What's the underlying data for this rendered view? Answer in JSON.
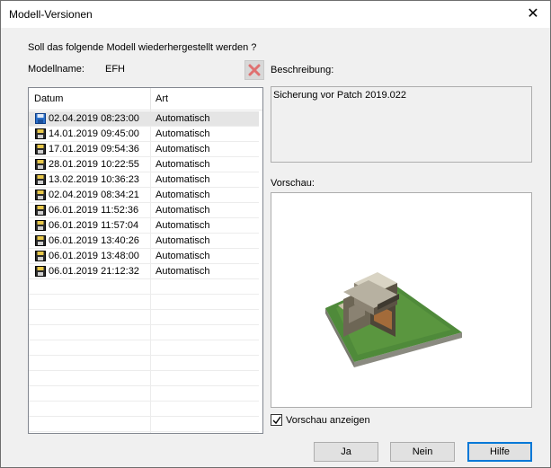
{
  "window": {
    "title": "Modell-Versionen"
  },
  "prompt": "Soll das folgende Modell wiederhergestellt werden ?",
  "model": {
    "label": "Modellname:",
    "value": "EFH"
  },
  "description": {
    "label": "Beschreibung:",
    "text": "Sicherung vor Patch 2019.022"
  },
  "preview": {
    "label": "Vorschau:",
    "checkbox_label": "Vorschau anzeigen",
    "checked": true
  },
  "list": {
    "columns": [
      "Datum",
      "Art"
    ],
    "rows": [
      {
        "date": "02.04.2019 08:23:00",
        "type": "Automatisch",
        "selected": true
      },
      {
        "date": "14.01.2019 09:45:00",
        "type": "Automatisch"
      },
      {
        "date": "17.01.2019 09:54:36",
        "type": "Automatisch"
      },
      {
        "date": "28.01.2019 10:22:55",
        "type": "Automatisch"
      },
      {
        "date": "13.02.2019 10:36:23",
        "type": "Automatisch"
      },
      {
        "date": "02.04.2019 08:34:21",
        "type": "Automatisch"
      },
      {
        "date": "06.01.2019 11:52:36",
        "type": "Automatisch"
      },
      {
        "date": "06.01.2019 11:57:04",
        "type": "Automatisch"
      },
      {
        "date": "06.01.2019 13:40:26",
        "type": "Automatisch"
      },
      {
        "date": "06.01.2019 13:48:00",
        "type": "Automatisch"
      },
      {
        "date": "06.01.2019 21:12:32",
        "type": "Automatisch"
      }
    ]
  },
  "buttons": {
    "yes": "Ja",
    "no": "Nein",
    "help": "Hilfe"
  },
  "icons": {
    "close": "close-icon",
    "delete": "delete-icon",
    "row": "floppy-disk-icon",
    "preview": "house-3d-preview"
  }
}
